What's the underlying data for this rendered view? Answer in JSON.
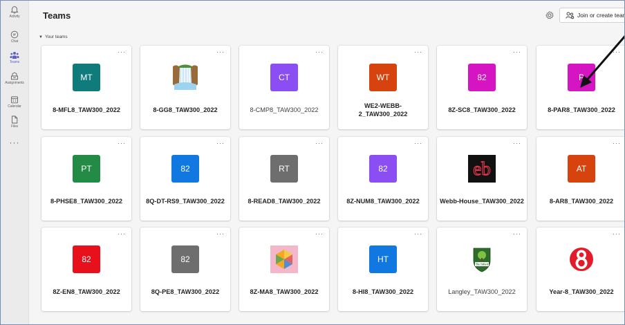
{
  "rail": [
    {
      "label": "Activity",
      "icon": "bell-icon"
    },
    {
      "label": "Chat",
      "icon": "chat-icon"
    },
    {
      "label": "Teams",
      "icon": "teams-icon"
    },
    {
      "label": "Assignments",
      "icon": "assignments-icon"
    },
    {
      "label": "Calendar",
      "icon": "calendar-icon"
    },
    {
      "label": "Files",
      "icon": "file-icon"
    }
  ],
  "rail_more": "···",
  "header": {
    "title": "Teams",
    "join_label": "Join or create team"
  },
  "section_label": "Your teams",
  "more_glyph": "···",
  "teams": [
    {
      "name": "8-MFL8_TAW300_2022",
      "initials": "MT",
      "color": "#0f7b7b",
      "style": "bold"
    },
    {
      "name": "8-GG8_TAW300_2022",
      "initials": "",
      "color": "#ffffff",
      "style": "bold",
      "image": "waterfall-picture"
    },
    {
      "name": "8-CMP8_TAW300_2022",
      "initials": "CT",
      "color": "#8a4ef2",
      "style": "normal"
    },
    {
      "name": "WE2-WEBB-2_TAW300_2022",
      "initials": "WT",
      "color": "#d7430f",
      "style": "bold"
    },
    {
      "name": "8Z-SC8_TAW300_2022",
      "initials": "82",
      "color": "#d514c2",
      "style": "bold"
    },
    {
      "name": "8-PAR8_TAW300_2022",
      "initials": "P",
      "color": "#d514c2",
      "style": "bold"
    },
    {
      "name": "8-PHSE8_TAW300_2022",
      "initials": "PT",
      "color": "#238b45",
      "style": "bold"
    },
    {
      "name": "8Q-DT-RS9_TAW300_2022",
      "initials": "82",
      "color": "#1078e0",
      "style": "bold"
    },
    {
      "name": "8-READ8_TAW300_2022",
      "initials": "RT",
      "color": "#6e6e6e",
      "style": "bold"
    },
    {
      "name": "8Z-NUM8_TAW300_2022",
      "initials": "82",
      "color": "#8a4ef2",
      "style": "bold"
    },
    {
      "name": "Webb-House_TAW300_2022",
      "initials": "eb",
      "color": "#111111",
      "style": "bold",
      "image": "eb-logo"
    },
    {
      "name": "8-AR8_TAW300_2022",
      "initials": "AT",
      "color": "#d7430f",
      "style": "bold"
    },
    {
      "name": "8Z-EN8_TAW300_2022",
      "initials": "82",
      "color": "#e8101a",
      "style": "bold"
    },
    {
      "name": "8Q-PE8_TAW300_2022",
      "initials": "82",
      "color": "#6e6e6e",
      "style": "bold"
    },
    {
      "name": "8Z-MA8_TAW300_2022",
      "initials": "",
      "color": "#f3b7c9",
      "style": "bold",
      "image": "hexagon-picture"
    },
    {
      "name": "8-HI8_TAW300_2022",
      "initials": "HT",
      "color": "#1078e0",
      "style": "bold"
    },
    {
      "name": "Langley_TAW300_2022",
      "initials": "The Telford",
      "color": "#ffffff",
      "style": "normal",
      "image": "telford-crest"
    },
    {
      "name": "Year-8_TAW300_2022",
      "initials": "8",
      "color": "#ffffff",
      "style": "bold",
      "image": "red-eight-logo"
    }
  ]
}
